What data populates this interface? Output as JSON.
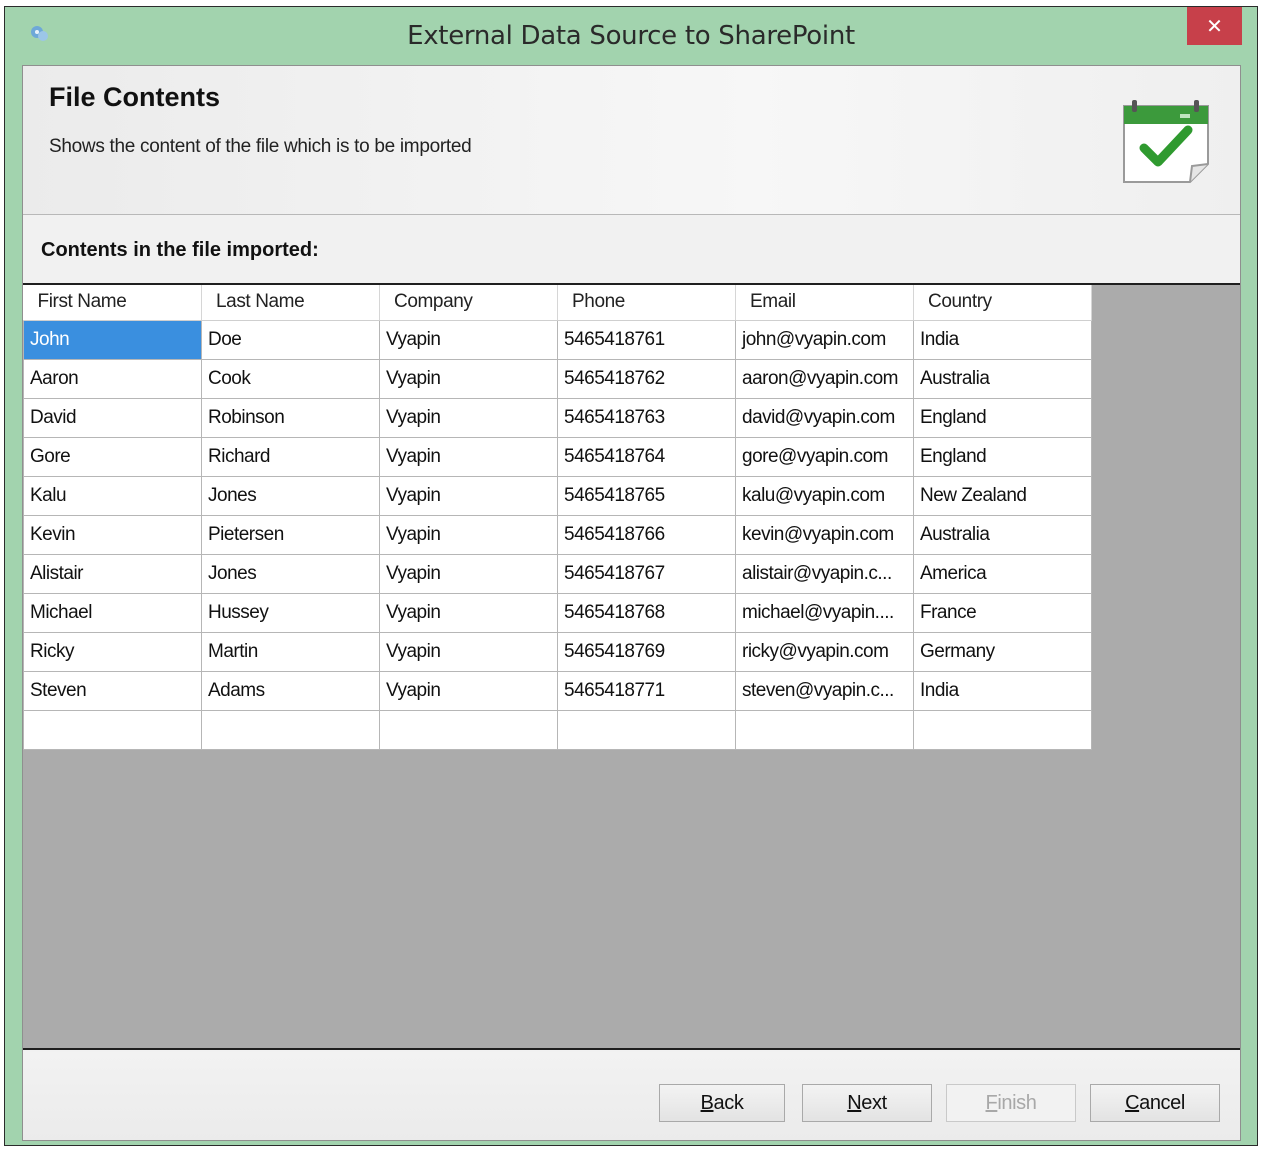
{
  "window": {
    "title": "External Data Source to SharePoint",
    "close_glyph": "✕"
  },
  "header": {
    "title": "File Contents",
    "description": "Shows the content of the file which is to be imported",
    "icon": "calendar-check-icon"
  },
  "section_label": "Contents in the file imported:",
  "grid": {
    "columns": [
      "First Name",
      "Last Name",
      "Company",
      "Phone",
      "Email",
      "Country"
    ],
    "rows": [
      [
        "John",
        "Doe",
        "Vyapin",
        "5465418761",
        "john@vyapin.com",
        "India"
      ],
      [
        "Aaron",
        "Cook",
        "Vyapin",
        "5465418762",
        "aaron@vyapin.com",
        "Australia"
      ],
      [
        "David",
        "Robinson",
        "Vyapin",
        "5465418763",
        "david@vyapin.com",
        "England"
      ],
      [
        "Gore",
        "Richard",
        "Vyapin",
        "5465418764",
        "gore@vyapin.com",
        "England"
      ],
      [
        "Kalu",
        "Jones",
        "Vyapin",
        "5465418765",
        "kalu@vyapin.com",
        "New Zealand"
      ],
      [
        "Kevin",
        "Pietersen",
        "Vyapin",
        "5465418766",
        "kevin@vyapin.com",
        "Australia"
      ],
      [
        "Alistair",
        "Jones",
        "Vyapin",
        "5465418767",
        "alistair@vyapin.c...",
        "America"
      ],
      [
        "Michael",
        "Hussey",
        "Vyapin",
        "5465418768",
        "michael@vyapin....",
        "France"
      ],
      [
        "Ricky",
        "Martin",
        "Vyapin",
        "5465418769",
        "ricky@vyapin.com",
        "Germany"
      ],
      [
        "Steven",
        "Adams",
        "Vyapin",
        "5465418771",
        "steven@vyapin.c...",
        "India"
      ]
    ]
  },
  "buttons": {
    "back": {
      "first": "B",
      "rest": "ack"
    },
    "next": {
      "first": "N",
      "rest": "ext"
    },
    "finish": {
      "first": "F",
      "rest": "inish"
    },
    "cancel": {
      "first": "C",
      "rest": "ancel"
    }
  },
  "colors": {
    "frame": "#a2d3ae",
    "close": "#c7404a",
    "selection": "#3a8fdf",
    "grid_background": "#ababab"
  }
}
